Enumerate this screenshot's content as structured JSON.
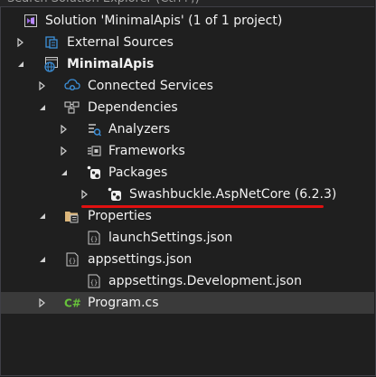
{
  "search": {
    "text": "Search Solution Explorer (Ctrl+;)"
  },
  "tree": [
    {
      "label": "Solution 'MinimalApis' (1 of 1 project)",
      "icon": "solution-icon",
      "expanded": null,
      "bold": false
    },
    {
      "label": "External Sources",
      "icon": "external-sources-icon",
      "expanded": false,
      "bold": false
    },
    {
      "label": "MinimalApis",
      "icon": "web-project-icon",
      "expanded": true,
      "bold": true
    },
    {
      "label": "Connected Services",
      "icon": "connected-services-icon",
      "expanded": false,
      "bold": false
    },
    {
      "label": "Dependencies",
      "icon": "dependencies-icon",
      "expanded": true,
      "bold": false
    },
    {
      "label": "Analyzers",
      "icon": "analyzers-icon",
      "expanded": false,
      "bold": false
    },
    {
      "label": "Frameworks",
      "icon": "frameworks-icon",
      "expanded": false,
      "bold": false
    },
    {
      "label": "Packages",
      "icon": "packages-icon",
      "expanded": true,
      "bold": false
    },
    {
      "label": "Swashbuckle.AspNetCore (6.2.3)",
      "icon": "package-icon",
      "expanded": false,
      "bold": false
    },
    {
      "label": "Properties",
      "icon": "properties-folder-icon",
      "expanded": true,
      "bold": false
    },
    {
      "label": "launchSettings.json",
      "icon": "json-file-icon",
      "expanded": null,
      "bold": false
    },
    {
      "label": "appsettings.json",
      "icon": "json-file-icon",
      "expanded": true,
      "bold": false
    },
    {
      "label": "appsettings.Development.json",
      "icon": "json-file-icon",
      "expanded": null,
      "bold": false
    },
    {
      "label": "Program.cs",
      "icon": "csharp-file-icon",
      "expanded": false,
      "bold": false
    }
  ],
  "colors": {
    "background": "#1f1f1f",
    "selection": "#3a3a3a",
    "highlight_underline": "#e01010",
    "csharp": "#67c23a",
    "json": "#d0d0d0",
    "folder": "#dcb67a"
  }
}
